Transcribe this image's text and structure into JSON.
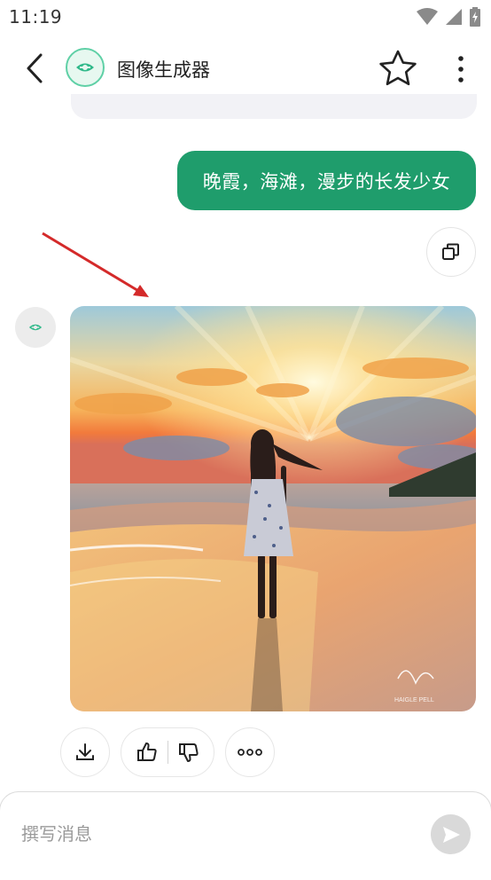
{
  "status_bar": {
    "time": "11:19"
  },
  "header": {
    "title": "图像生成器",
    "back_icon": "chevron-left-icon",
    "favorite_icon": "star-outline-icon",
    "menu_icon": "more-vertical-icon"
  },
  "chat": {
    "user_message": "晚霞，海滩，漫步的长发少女",
    "generated_image": {
      "signature": "Vin Ning",
      "subtext": "HAIGLE PELL"
    }
  },
  "actions": [
    "download-icon",
    "thumbs-up-icon",
    "thumbs-down-icon",
    "more-horizontal-icon"
  ],
  "composer": {
    "placeholder": "撰写消息",
    "send_icon": "send-icon"
  },
  "colors": {
    "accent": "#1f9d6c",
    "annotation_arrow": "#d42a2a"
  }
}
